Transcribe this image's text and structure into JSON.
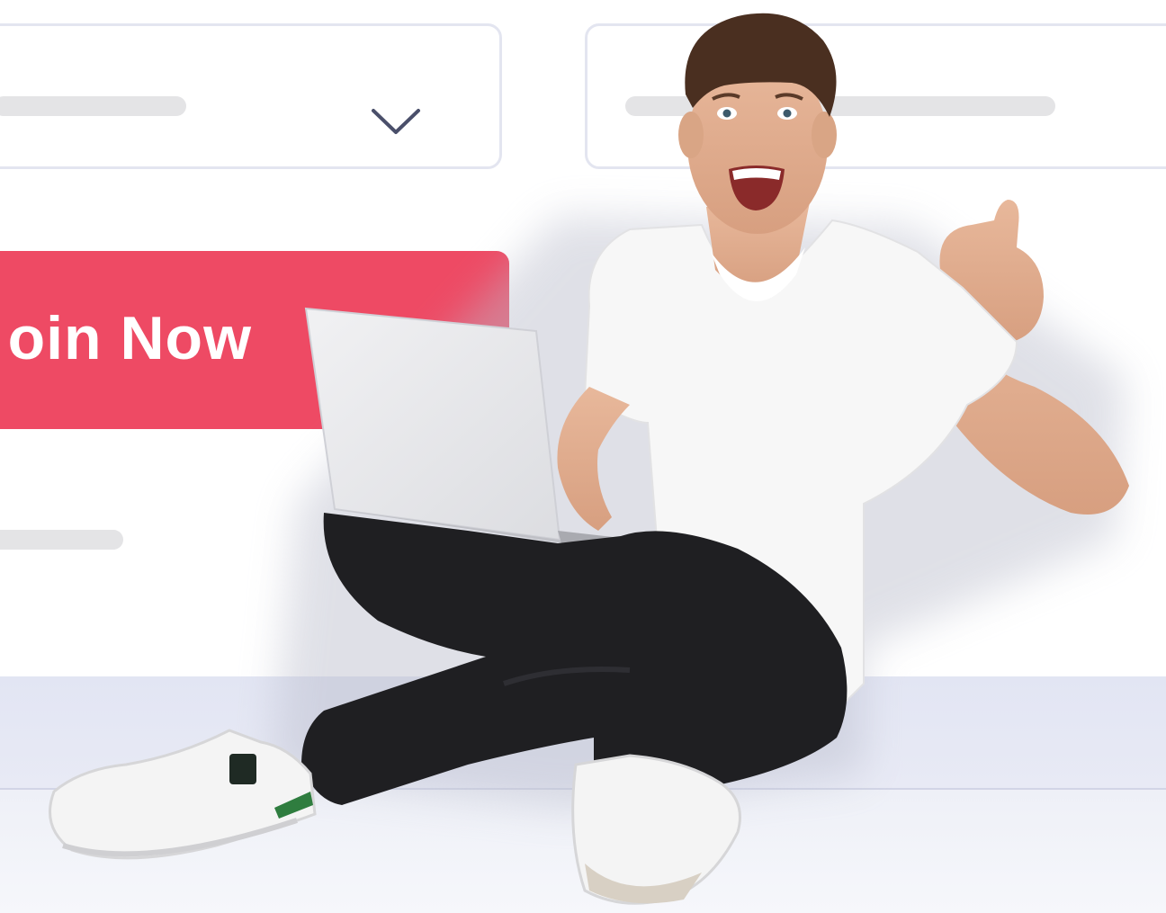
{
  "form": {
    "join_button_label": "oin Now"
  },
  "colors": {
    "accent": "#ee4a64",
    "field_border": "#e3e5f0",
    "placeholder": "#e4e4e6",
    "ledge": "#e2e5f3"
  },
  "icons": {
    "dropdown": "chevron-down-icon",
    "photo": "person-photo"
  }
}
